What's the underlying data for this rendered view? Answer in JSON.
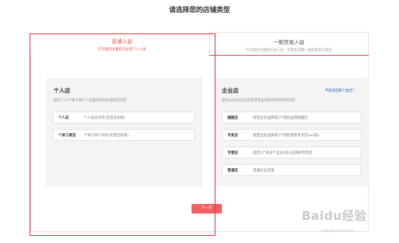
{
  "page_title": "请选择您的店铺类型",
  "tabs": [
    {
      "title": "普通入驻",
      "subtitle": "针对境内注册的企业或个人入驻"
    },
    {
      "title": "一般贸易入驻",
      "subtitle": "针对境内注册的企业入驻，仅售卖向我一般贸易进口商品"
    }
  ],
  "personal": {
    "title": "个人店",
    "desc": "适合个人/个体工商户入驻提供身份证等即可开店",
    "options": [
      {
        "label": "个人店",
        "desc": "个人身份开店(无营业执照)"
      },
      {
        "label": "个体工商店",
        "desc": "个体工商户开店(有营业执照)"
      }
    ]
  },
  "company": {
    "title": "企业店",
    "desc": "适合公司/企业开店提供营业执照等资料即可开店",
    "help_link": "不知道选哪个类型?",
    "options": [
      {
        "label": "旗舰店",
        "desc": "经营自有品牌或1个授权品牌旗舰店"
      },
      {
        "label": "专卖店",
        "desc": "经营自有品牌或1个授权销售专卖店(≥2类)"
      },
      {
        "label": "专营店",
        "desc": "经营1个或多个自有/他人品牌的专营店"
      },
      {
        "label": "普通店",
        "desc": "普通企业店铺"
      }
    ]
  },
  "next_button": "下一步",
  "watermark": {
    "text": "Baidu经验",
    "sub": "jingyan.baidu.com"
  },
  "colors": {
    "accent": "#e84b4b",
    "link": "#2a64b8",
    "highlight": "#e8323c"
  }
}
